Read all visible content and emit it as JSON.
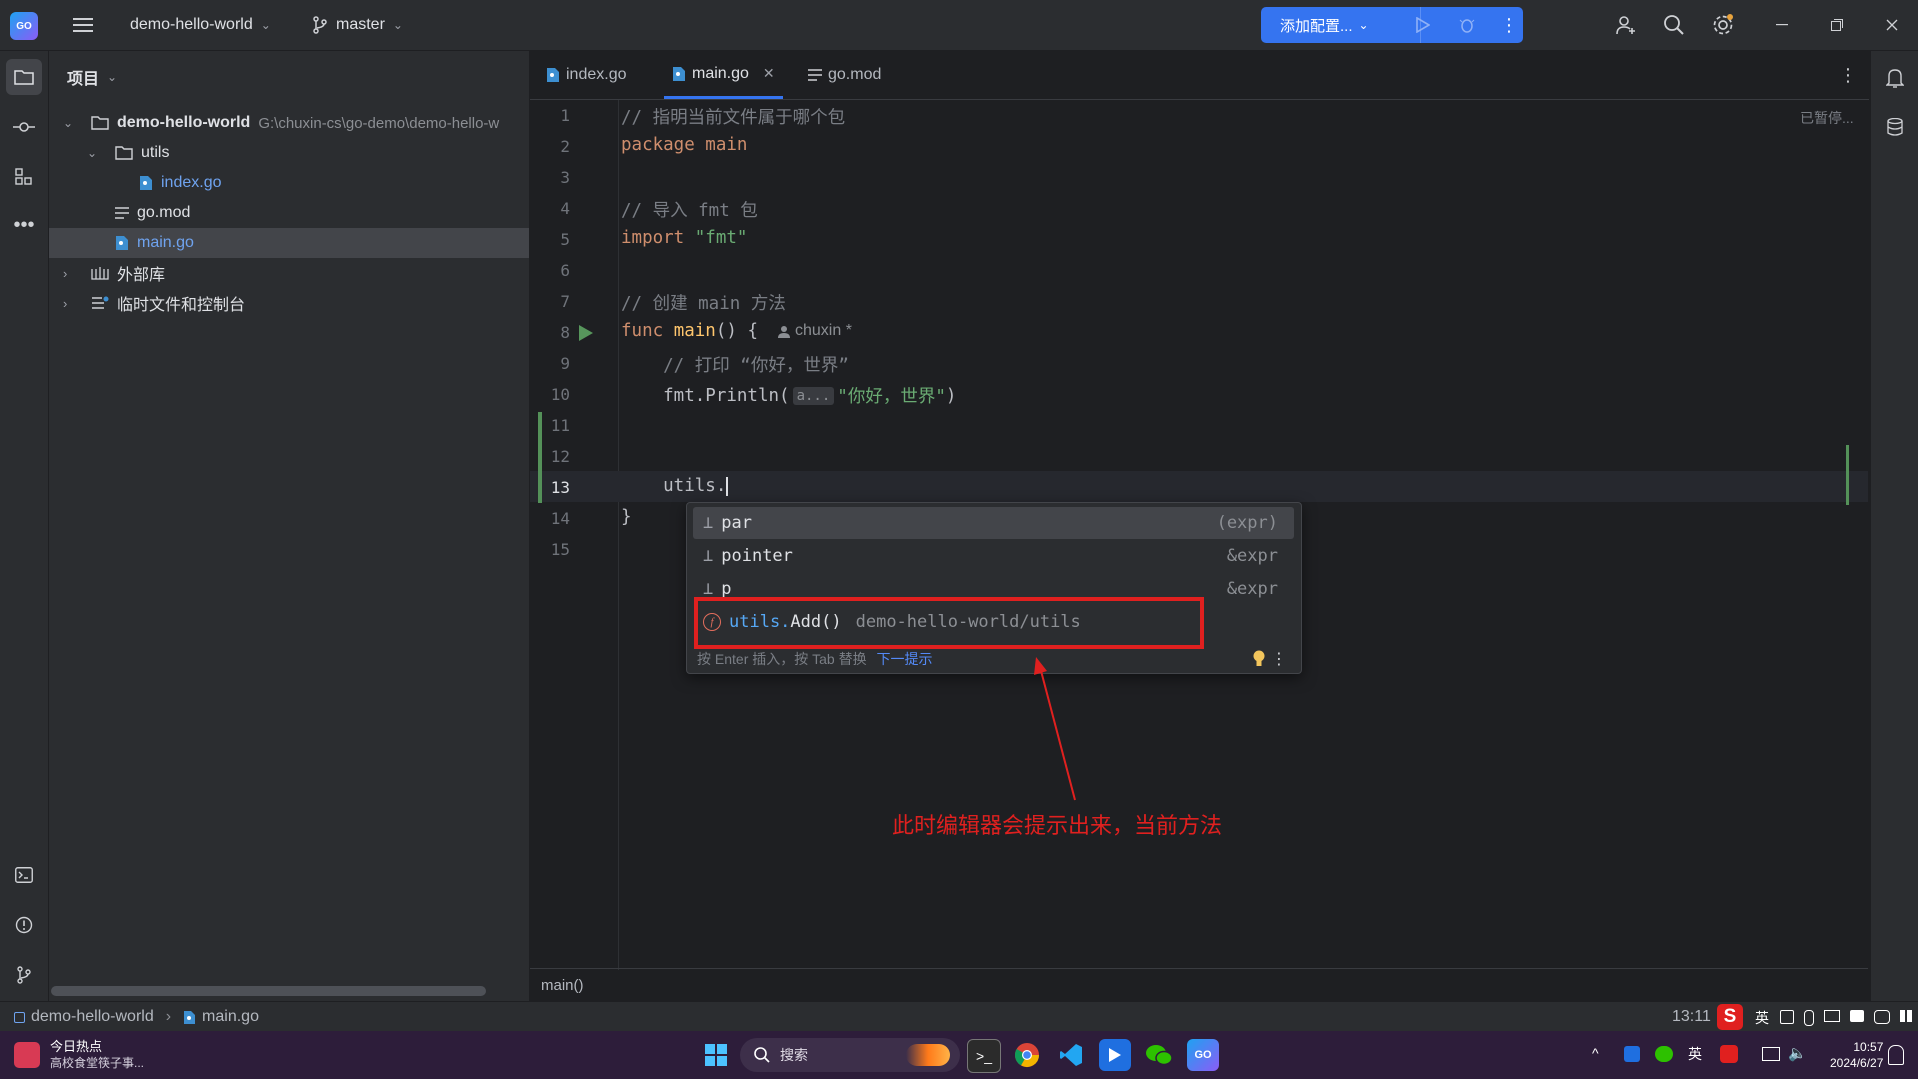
{
  "titlebar": {
    "project_name": "demo-hello-world",
    "branch": "master",
    "run_config_label": "添加配置..."
  },
  "project_panel": {
    "title": "项目",
    "root": {
      "name": "demo-hello-world",
      "path": "G:\\chuxin-cs\\go-demo\\demo-hello-w"
    },
    "items": [
      {
        "label": "utils"
      },
      {
        "label": "index.go"
      },
      {
        "label": "go.mod"
      },
      {
        "label": "main.go"
      },
      {
        "label": "外部库"
      },
      {
        "label": "临时文件和控制台"
      }
    ]
  },
  "tabs": [
    {
      "label": "index.go"
    },
    {
      "label": "main.go"
    },
    {
      "label": "go.mod"
    }
  ],
  "editor": {
    "paused_label": "已暂停...",
    "line_numbers": [
      "1",
      "2",
      "3",
      "4",
      "5",
      "6",
      "7",
      "8",
      "9",
      "10",
      "11",
      "12",
      "13",
      "14",
      "15"
    ],
    "lines": {
      "l1": "// 指明当前文件属于哪个包",
      "l2_kw": "package",
      "l2_rest": " main",
      "l4": "// 导入 fmt 包",
      "l5_kw": "import",
      "l5_str": " \"fmt\"",
      "l7": "// 创建 main 方法",
      "l8_kw": "func",
      "l8_fn": " main",
      "l8_rest": "() {",
      "l8_author": "chuxin *",
      "l9": "    // 打印 “你好，世界”",
      "l10_a": "    fmt.Println(",
      "l10_hint": "a...",
      "l10_str": "\"你好，世界\"",
      "l10_end": ")",
      "l13": "    utils.",
      "l14": "}"
    },
    "breadcrumb": "main()"
  },
  "completion": {
    "items": [
      {
        "name": "par",
        "type": "(expr)"
      },
      {
        "name": "pointer",
        "type": "&expr"
      },
      {
        "name": "p",
        "type": "&expr"
      },
      {
        "name_a": "utils.",
        "name_b": "Add()",
        "detail": "demo-hello-world/utils"
      }
    ],
    "footer_text": "按 Enter 插入，按 Tab 替换",
    "footer_link": "下一提示"
  },
  "annotation": {
    "text": "此时编辑器会提示出来，当前方法",
    "color": "#e0201f"
  },
  "statusbar": {
    "project": "demo-hello-world",
    "file": "main.go",
    "position": "13:11",
    "ime": "英"
  },
  "taskbar": {
    "news_title": "今日热点",
    "news_sub": "高校食堂筷子事...",
    "search_placeholder": "搜索",
    "lang": "英",
    "time": "10:57",
    "date": "2024/6/27"
  },
  "colors": {
    "accent": "#3574f0",
    "background": "#1e1f22",
    "panel": "#2b2d30"
  }
}
